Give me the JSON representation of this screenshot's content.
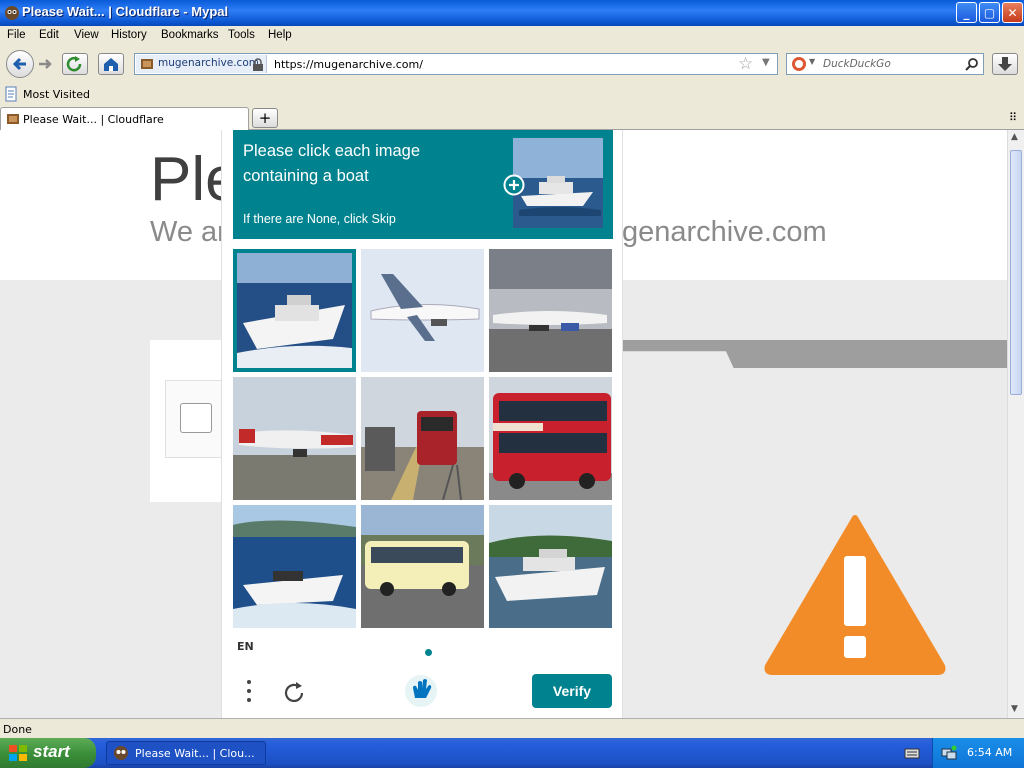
{
  "window": {
    "title": "Please Wait... | Cloudflare - Mypal",
    "min": "_",
    "max": "▢",
    "close": "✕"
  },
  "menu": [
    "File",
    "Edit",
    "View",
    "History",
    "Bookmarks",
    "Tools",
    "Help"
  ],
  "nav": {
    "identity": "mugenarchive.com",
    "url": "https://mugenarchive.com/",
    "search_placeholder": "DuckDuckGo"
  },
  "bookmarks": {
    "most_visited": "Most Visited"
  },
  "tab": {
    "label": "Please Wait... | Cloudflare",
    "new_tab": "+"
  },
  "page": {
    "heading_partial": "Ple",
    "subheading_left": "We ar",
    "subheading_right": "genarchive.com"
  },
  "captcha": {
    "prompt_line1": "Please click each image",
    "prompt_line2": "containing a boat",
    "prompt_hint": "If there are None, click Skip",
    "language": "EN",
    "verify_label": "Verify",
    "tiles": [
      {
        "subject": "boat",
        "selected": true
      },
      {
        "subject": "airplane",
        "selected": false
      },
      {
        "subject": "airplane",
        "selected": false
      },
      {
        "subject": "airplane",
        "selected": false
      },
      {
        "subject": "train",
        "selected": false
      },
      {
        "subject": "bus",
        "selected": false
      },
      {
        "subject": "boat",
        "selected": false
      },
      {
        "subject": "bus",
        "selected": false
      },
      {
        "subject": "boat",
        "selected": false
      }
    ],
    "accent_color": "#00838f"
  },
  "status": {
    "text": "Done"
  },
  "taskbar": {
    "start_label": "start",
    "task_item": "Please Wait... | Clou...",
    "clock": "6:54 AM"
  },
  "colors": {
    "warning": "#f28c28"
  }
}
